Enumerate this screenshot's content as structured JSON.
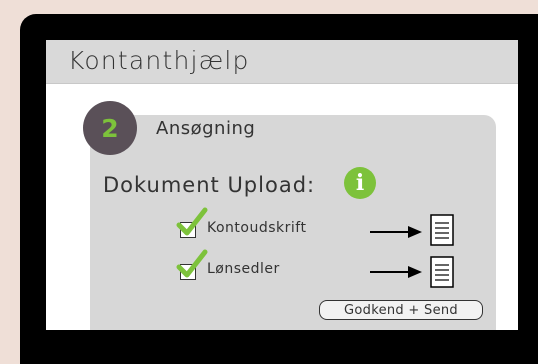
{
  "app": {
    "title": "Kontanthjælp"
  },
  "step": {
    "number": "2",
    "title": "Ansøgning"
  },
  "upload": {
    "heading": "Dokument Upload:",
    "info_icon_glyph": "i",
    "items": [
      {
        "label": "Kontoudskrift",
        "checked": true
      },
      {
        "label": "Lønsedler",
        "checked": true
      }
    ]
  },
  "actions": {
    "send_label": "Godkend + Send"
  },
  "colors": {
    "accent": "#7dc23b",
    "step_circle": "#5a5058",
    "card": "#d7d7d7",
    "titlebar": "#d9d9d9"
  }
}
